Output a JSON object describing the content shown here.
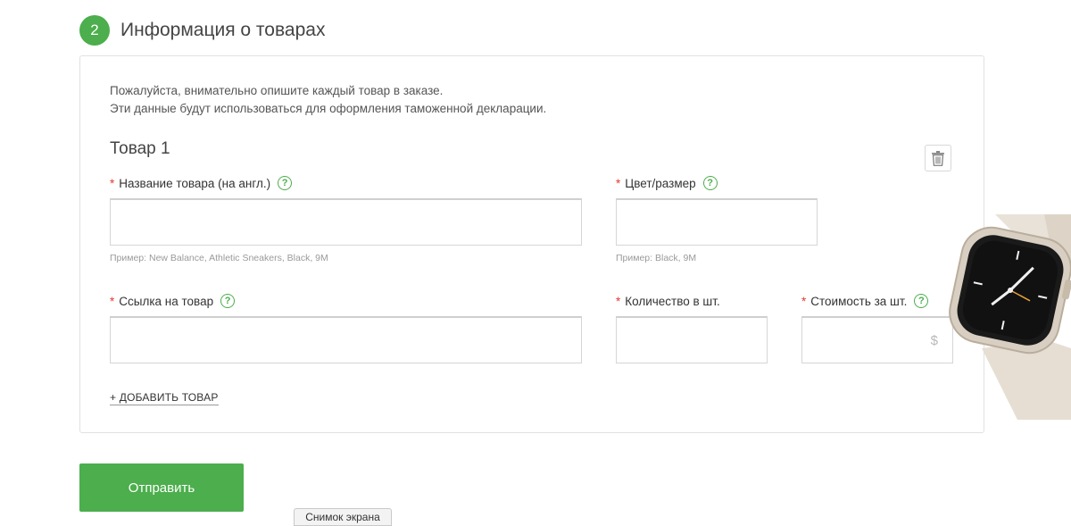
{
  "step": {
    "number": "2",
    "title": "Информация о товарах"
  },
  "intro": {
    "line1": "Пожалуйста, внимательно опишите каждый товар в заказе.",
    "line2": "Эти данные будут использоваться для оформления таможенной декларации."
  },
  "item": {
    "title": "Товар 1"
  },
  "fields": {
    "name": {
      "label": "Название товара (на англ.)",
      "value": "",
      "hint": "Пример: New Balance, Athletic Sneakers, Black, 9M"
    },
    "color": {
      "label": "Цвет/размер",
      "value": "",
      "hint": "Пример: Black, 9M"
    },
    "link": {
      "label": "Ссылка на товар",
      "value": ""
    },
    "quantity": {
      "label": "Количество в шт.",
      "value": ""
    },
    "price": {
      "label": "Стоимость за шт.",
      "value": "",
      "currency": "$"
    }
  },
  "required_mark": "*",
  "help_glyph": "?",
  "add_item_label": "+ ДОБАВИТЬ ТОВАР",
  "submit_label": "Отправить",
  "tooltip_label": "Снимок экрана",
  "colors": {
    "accent": "#4cae4c",
    "required": "#e53935"
  },
  "icons": {
    "delete": "trash-icon",
    "help": "question-circle-icon"
  }
}
